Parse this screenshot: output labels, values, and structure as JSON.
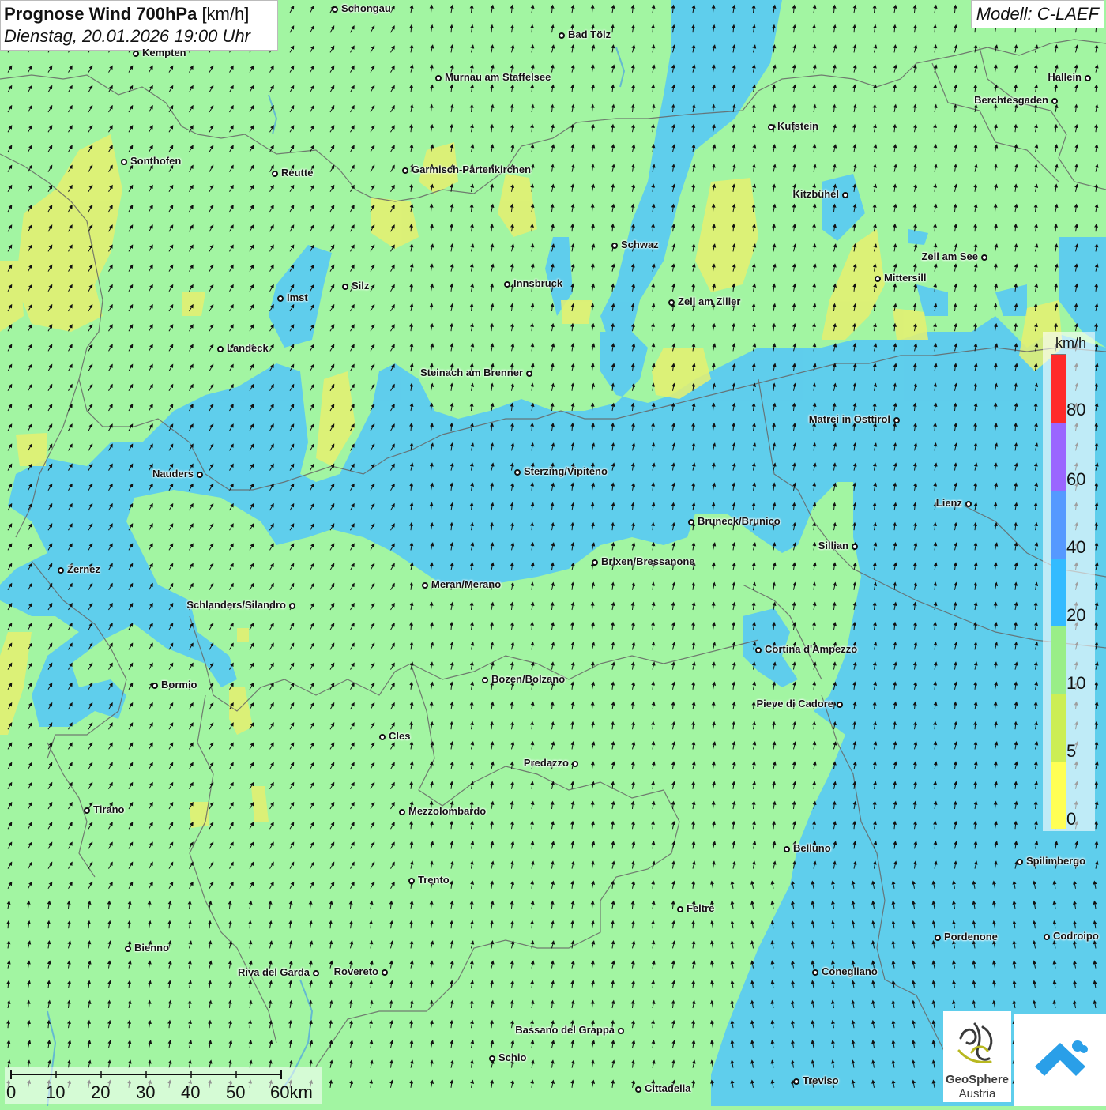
{
  "title": {
    "main": "Prognose Wind 700hPa",
    "unit": "[km/h]",
    "datetime": "Dienstag, 20.01.2026 19:00 Uhr"
  },
  "model": "Modell: C-LAEF",
  "legend": {
    "unit": "km/h",
    "ticks": [
      "80",
      "60",
      "40",
      "20",
      "10",
      "5",
      "0"
    ],
    "colors": [
      "#ff2a2a",
      "#9a66ff",
      "#5599ff",
      "#33bbff",
      "#99ee88",
      "#ccee55",
      "#ffff55"
    ]
  },
  "scalebar": {
    "labels": [
      "0",
      "10",
      "20",
      "30",
      "40",
      "50",
      "60km"
    ]
  },
  "logos": {
    "geosphere_line1": "GeoSphere",
    "geosphere_line2": "Austria"
  },
  "colors": {
    "calm": "#ffff66",
    "light": "#a2f5a2",
    "moderate": "#55c8ee",
    "border": "#666666"
  },
  "wind_arrow_direction": "north (northeast in west)",
  "cities": [
    "Schongau",
    "Bad Tölz",
    "Kempten",
    "Murnau am Staffelsee",
    "Hallein",
    "Berchtesgaden",
    "Kufstein",
    "Sonthofen",
    "Reutte",
    "Garmisch-Partenkirchen",
    "Kitzbühel",
    "Schwaz",
    "Zell am See",
    "Mittersill",
    "Innsbruck",
    "Silz",
    "Imst",
    "Zell am Ziller",
    "Landeck",
    "Steinach am Brenner",
    "Matrei in Osttirol",
    "Nauders",
    "Sterzing/Vipiteno",
    "Lienz",
    "Bruneck/Brunico",
    "Sillian",
    "Zernez",
    "Brixen/Bressanone",
    "Meran/Merano",
    "Schlanders/Silandro",
    "Cortina d'Ampezzo",
    "Bozen/Bolzano",
    "Bormio",
    "Pieve di Cadore",
    "Cles",
    "Predazzo",
    "Tirano",
    "Mezzolombardo",
    "Belluno",
    "Spilimbergo",
    "Trento",
    "Feltre",
    "Pordenone",
    "Codroipo",
    "Bienno",
    "Riva del Garda",
    "Rovereto",
    "Conegliano",
    "Bassano del Grappa",
    "Schio",
    "Treviso",
    "Cittadella"
  ]
}
